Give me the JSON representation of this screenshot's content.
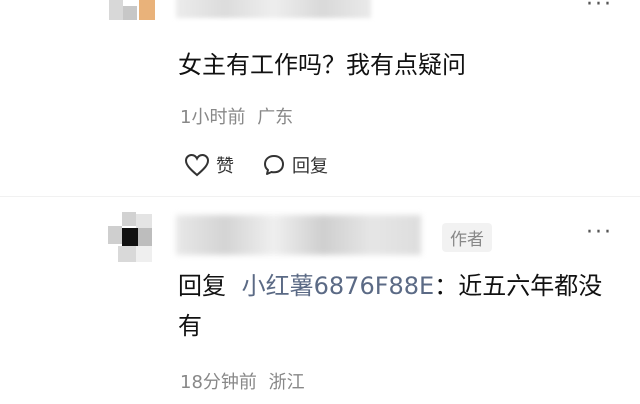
{
  "comments": [
    {
      "text": "女主有工作吗？我有点疑问",
      "time": "1小时前",
      "location": "广东",
      "like_label": "赞",
      "reply_label": "回复",
      "more_label": "···"
    },
    {
      "badge": "作者",
      "reply_prefix": "回复",
      "mention": "小红薯6876F88E",
      "separator": "：",
      "text": "近五六年都没有",
      "time": "18分钟前",
      "location": "浙江",
      "more_label": "···"
    }
  ],
  "icons": [
    "heart-icon",
    "speech-bubble-icon"
  ]
}
